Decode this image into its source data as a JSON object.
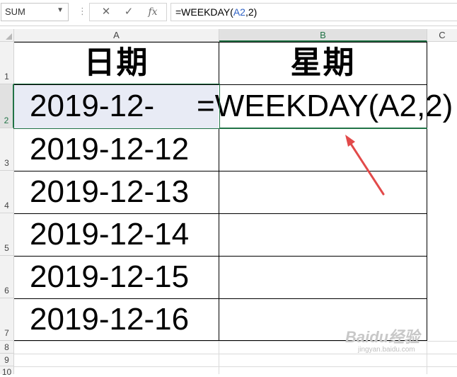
{
  "formula_bar": {
    "name_box": "SUM",
    "cancel_icon": "✕",
    "enter_icon": "✓",
    "fx_label": "fx",
    "formula_prefix": "=WEEKDAY(",
    "formula_ref": "A2",
    "formula_suffix": ",2)"
  },
  "columns": [
    "A",
    "B",
    "C"
  ],
  "rows": [
    "1",
    "2",
    "3",
    "4",
    "5",
    "6",
    "7",
    "8",
    "9",
    "10"
  ],
  "cells": {
    "A1": "日期",
    "B1": "星期",
    "A2": "2019-12-",
    "A3": "2019-12-12",
    "A4": "2019-12-13",
    "A5": "2019-12-14",
    "A6": "2019-12-15",
    "A7": "2019-12-16",
    "B2": "=WEEKDAY(A2,2)"
  },
  "watermark": {
    "brand": "Baidu经验",
    "url": "jingyan.baidu.com"
  },
  "colors": {
    "accent": "#217346",
    "ref_blue": "#2f62c5",
    "arrow": "#e24a4a"
  }
}
